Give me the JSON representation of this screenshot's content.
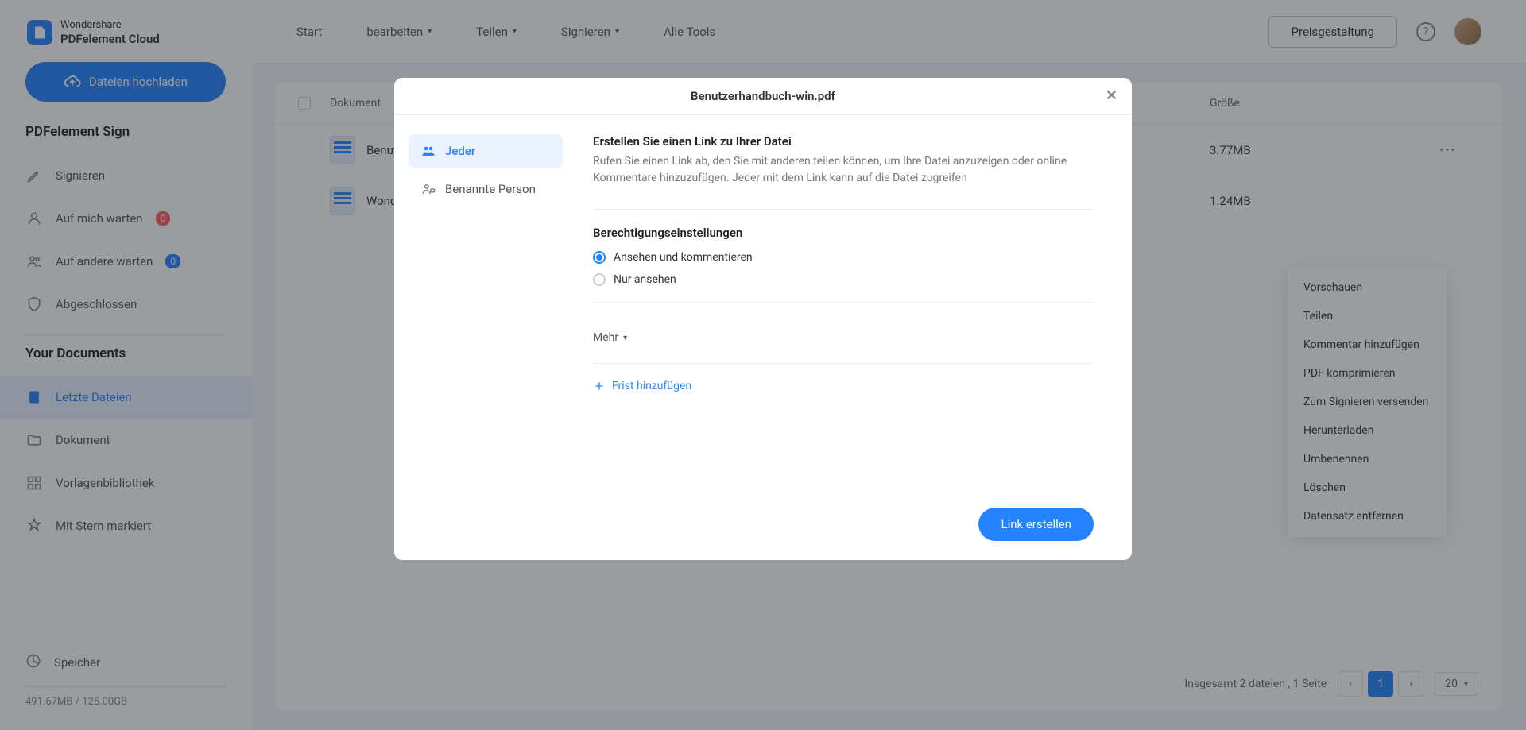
{
  "brand": {
    "line1": "Wondershare",
    "line2": "PDFelement Cloud"
  },
  "upload_label": "Dateien hochladen",
  "sign_section": "PDFelement Sign",
  "sign_nav": [
    {
      "label": "Signieren"
    },
    {
      "label": "Auf mich warten",
      "badge": "0"
    },
    {
      "label": "Auf andere warten",
      "badge": "0"
    },
    {
      "label": "Abgeschlossen"
    }
  ],
  "docs_section": "Your Documents",
  "docs_nav": [
    {
      "label": "Letzte Dateien"
    },
    {
      "label": "Dokument"
    },
    {
      "label": "Vorlagenbibliothek"
    },
    {
      "label": "Mit Stern markiert"
    }
  ],
  "storage": {
    "label": "Speicher",
    "text": "491.67MB / 125.00GB"
  },
  "topnav": [
    {
      "label": "Start"
    },
    {
      "label": "bearbeiten"
    },
    {
      "label": "Teilen"
    },
    {
      "label": "Signieren"
    },
    {
      "label": "Alle Tools"
    }
  ],
  "pricing": "Preisgestaltung",
  "table": {
    "col_doc": "Dokument",
    "col_size": "Größe",
    "rows": [
      {
        "name": "Benutzerhandbuch-win.pdf",
        "size": "3.77MB"
      },
      {
        "name": "Wondershare-Sample.pdf",
        "size": "1.24MB"
      }
    ]
  },
  "context_menu": [
    "Vorschauen",
    "Teilen",
    "Kommentar hinzufügen",
    "PDF komprimieren",
    "Zum Signieren versenden",
    "Herunterladen",
    "Umbenennen",
    "Löschen",
    "Datensatz entfernen"
  ],
  "footer": {
    "summary": "Insgesamt 2 dateien , 1 Seite",
    "page": "1",
    "page_size": "20"
  },
  "modal": {
    "title": "Benutzerhandbuch-win.pdf",
    "tab_everyone": "Jeder",
    "tab_named": "Benannte Person",
    "heading": "Erstellen Sie einen Link zu Ihrer Datei",
    "desc": "Rufen Sie einen Link ab, den Sie mit anderen teilen können, um Ihre Datei anzuzeigen oder online Kommentare hinzuzufügen. Jeder mit dem Link kann auf die Datei zugreifen",
    "perm_heading": "Berechtigungseinstellungen",
    "perm_comment": "Ansehen und kommentieren",
    "perm_view": "Nur ansehen",
    "more": "Mehr",
    "add_deadline": "Frist hinzufügen",
    "create": "Link erstellen"
  }
}
